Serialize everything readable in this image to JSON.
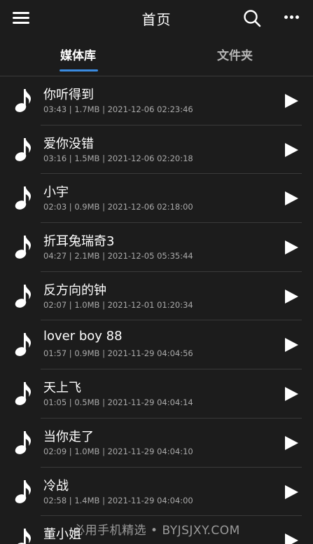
{
  "header": {
    "title": "首页"
  },
  "tabs": [
    {
      "label": "媒体库",
      "active": true
    },
    {
      "label": "文件夹",
      "active": false
    }
  ],
  "colors": {
    "background": "#1c1c1c",
    "accent": "#3a8be0",
    "meta_text": "#a9a9a9"
  },
  "songs": [
    {
      "name": "你听得到",
      "meta": "03:43 | 1.7MB | 2021-12-06 02:23:46"
    },
    {
      "name": "爱你没错",
      "meta": "03:16 | 1.5MB | 2021-12-06 02:20:18"
    },
    {
      "name": "小宇",
      "meta": "02:03 | 0.9MB | 2021-12-06 02:18:00"
    },
    {
      "name": "折耳兔瑞奇3",
      "meta": "04:27 | 2.1MB | 2021-12-05 05:35:44"
    },
    {
      "name": "反方向的钟",
      "meta": "02:07 | 1.0MB | 2021-12-01 01:20:34"
    },
    {
      "name": "lover boy 88",
      "meta": "01:57 | 0.9MB | 2021-11-29 04:04:56"
    },
    {
      "name": "天上飞",
      "meta": "01:05 | 0.5MB | 2021-11-29 04:04:14"
    },
    {
      "name": "当你走了",
      "meta": "02:09 | 1.0MB | 2021-11-29 04:04:10"
    },
    {
      "name": "冷战",
      "meta": "02:58 | 1.4MB | 2021-11-29 04:04:00"
    },
    {
      "name": "董小姐",
      "meta": ""
    }
  ],
  "watermark": "必用手机精选 • BYJSJXY.COM"
}
